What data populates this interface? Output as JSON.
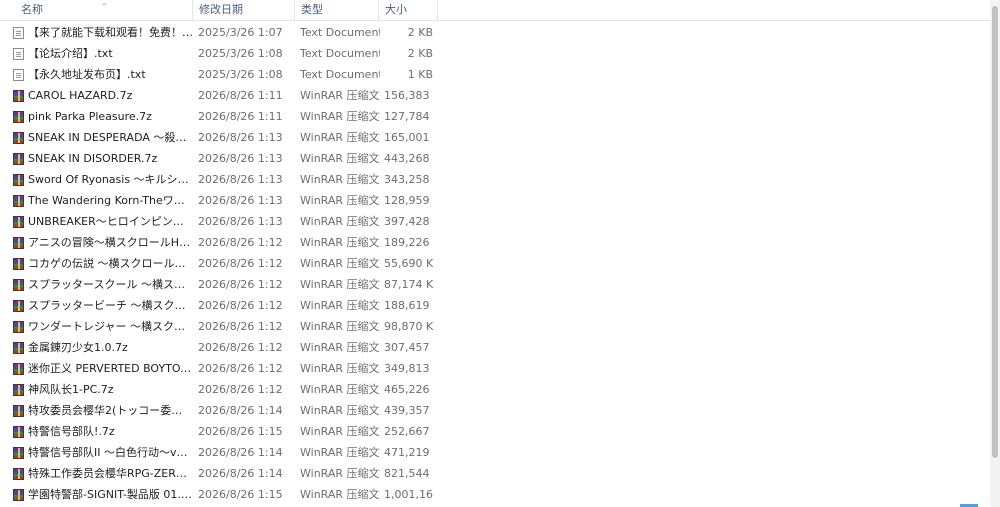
{
  "columns": {
    "name": "名称",
    "date": "修改日期",
    "type": "类型",
    "size": "大小",
    "sort_indicator": "^"
  },
  "files": [
    {
      "name": "【来了就能下载和观看！免费！】.txt",
      "date": "2025/3/26 1:07",
      "type": "Text Document",
      "size": "2 KB",
      "icon": "text-file-icon"
    },
    {
      "name": "【论坛介绍】.txt",
      "date": "2025/3/26 1:08",
      "type": "Text Document",
      "size": "2 KB",
      "icon": "text-file-icon"
    },
    {
      "name": "【永久地址发布页】.txt",
      "date": "2025/3/26 1:08",
      "type": "Text Document",
      "size": "1 KB",
      "icon": "text-file-icon"
    },
    {
      "name": "CAROL HAZARD.7z",
      "date": "2026/8/26 1:11",
      "type": "WinRAR 压缩文件",
      "size": "156,383 KB",
      "icon": "winrar-archive-icon"
    },
    {
      "name": "pink Parka Pleasure.7z",
      "date": "2026/8/26 1:11",
      "type": "WinRAR 压缩文件",
      "size": "127,784 KB",
      "icon": "winrar-archive-icon"
    },
    {
      "name": "SNEAK IN DESPERADA ～殺し屋少女...",
      "date": "2026/8/26 1:13",
      "type": "WinRAR 压缩文件",
      "size": "165,001 KB",
      "icon": "winrar-archive-icon"
    },
    {
      "name": "SNEAK IN DISORDER.7z",
      "date": "2026/8/26 1:13",
      "type": "WinRAR 压缩文件",
      "size": "443,268 KB",
      "icon": "winrar-archive-icon"
    },
    {
      "name": "Sword Of Ryonasis ～キルシュと淫獄...",
      "date": "2026/8/26 1:13",
      "type": "WinRAR 压缩文件",
      "size": "343,258 KB",
      "icon": "winrar-archive-icon"
    },
    {
      "name": "The Wandering Korn-Theワンダリン...",
      "date": "2026/8/26 1:13",
      "type": "WinRAR 压缩文件",
      "size": "128,959 KB",
      "icon": "winrar-archive-icon"
    },
    {
      "name": "UNBREAKER～ヒロインピンチベルトア...",
      "date": "2026/8/26 1:13",
      "type": "WinRAR 压缩文件",
      "size": "397,428 KB",
      "icon": "winrar-archive-icon"
    },
    {
      "name": "アニスの冒険～横スクロールHアクショ...",
      "date": "2026/8/26 1:12",
      "type": "WinRAR 压缩文件",
      "size": "189,226 KB",
      "icon": "winrar-archive-icon"
    },
    {
      "name": "コカゲの伝説 ～横スクロールHアクシ...",
      "date": "2026/8/26 1:12",
      "type": "WinRAR 压缩文件",
      "size": "55,690 KB",
      "icon": "winrar-archive-icon"
    },
    {
      "name": "スプラッタースクール ～横スクロール...",
      "date": "2026/8/26 1:12",
      "type": "WinRAR 压缩文件",
      "size": "87,174 KB",
      "icon": "winrar-archive-icon"
    },
    {
      "name": "スプラッタービーチ ～横スクロールエ...",
      "date": "2026/8/26 1:12",
      "type": "WinRAR 压缩文件",
      "size": "188,619 KB",
      "icon": "winrar-archive-icon"
    },
    {
      "name": "ワンダートレジャー ～横スクロールエ...",
      "date": "2026/8/26 1:12",
      "type": "WinRAR 压缩文件",
      "size": "98,870 KB",
      "icon": "winrar-archive-icon"
    },
    {
      "name": "金属錬刃少女1.0.7z",
      "date": "2026/8/26 1:12",
      "type": "WinRAR 压缩文件",
      "size": "307,457 KB",
      "icon": "winrar-archive-icon"
    },
    {
      "name": "迷你正义 PERVERTED BOYTOY ～タイ...",
      "date": "2026/8/26 1:12",
      "type": "WinRAR 压缩文件",
      "size": "349,813 KB",
      "icon": "winrar-archive-icon"
    },
    {
      "name": "神风队长1-PC.7z",
      "date": "2026/8/26 1:12",
      "type": "WinRAR 压缩文件",
      "size": "465,226 KB",
      "icon": "winrar-archive-icon"
    },
    {
      "name": "特攻委员会樱华2(トッコー委員会オウカ...",
      "date": "2026/8/26 1:14",
      "type": "WinRAR 压缩文件",
      "size": "439,357 KB",
      "icon": "winrar-archive-icon"
    },
    {
      "name": "特警信号部队!.7z",
      "date": "2026/8/26 1:15",
      "type": "WinRAR 压缩文件",
      "size": "252,667 KB",
      "icon": "winrar-archive-icon"
    },
    {
      "name": "特警信号部队II ～白色行动～v1.0.7.7z",
      "date": "2026/8/26 1:14",
      "type": "WinRAR 压缩文件",
      "size": "471,219 KB",
      "icon": "winrar-archive-icon"
    },
    {
      "name": "特殊工作委员会樱华RPG-ZERO.7z",
      "date": "2026/8/26 1:14",
      "type": "WinRAR 压缩文件",
      "size": "821,544 KB",
      "icon": "winrar-archive-icon"
    },
    {
      "name": "学園特警部-SIGNIT-製品版 01.3.7z",
      "date": "2026/8/26 1:15",
      "type": "WinRAR 压缩文件",
      "size": "1,001,167...",
      "icon": "winrar-archive-icon"
    }
  ]
}
